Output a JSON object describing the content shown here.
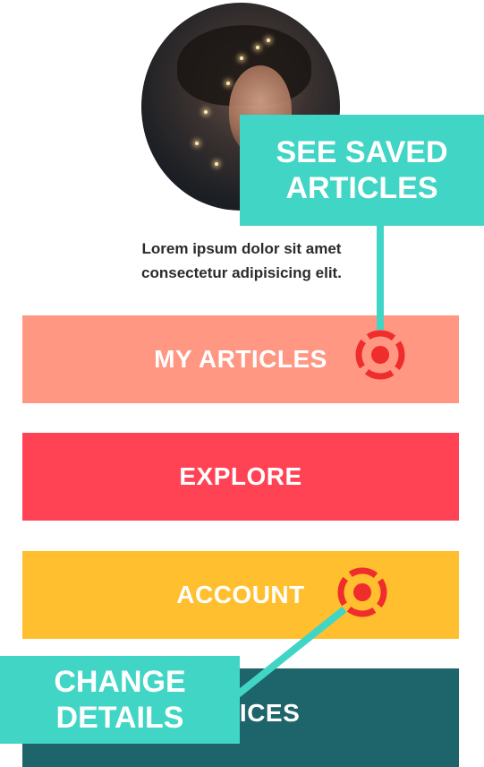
{
  "profile": {
    "bio_line1": "Lorem ipsum dolor sit amet",
    "bio_line2": "consectetur adipisicing elit."
  },
  "menu": {
    "articles_label": "MY ARTICLES",
    "explore_label": "EXPLORE",
    "account_label": "ACCOUNT",
    "devices_label": "VICES"
  },
  "callouts": {
    "saved_line1": "SEE SAVED",
    "saved_line2": "ARTICLES",
    "details_line1": "CHANGE",
    "details_line2": "DETAILS"
  },
  "colors": {
    "articles": "#ff9783",
    "explore": "#ff4354",
    "account": "#ffbf2e",
    "devices": "#1e646b",
    "callout": "#40d5c4",
    "target": "#ef2d2d"
  },
  "icons": {
    "target": "crosshair-target-icon"
  }
}
